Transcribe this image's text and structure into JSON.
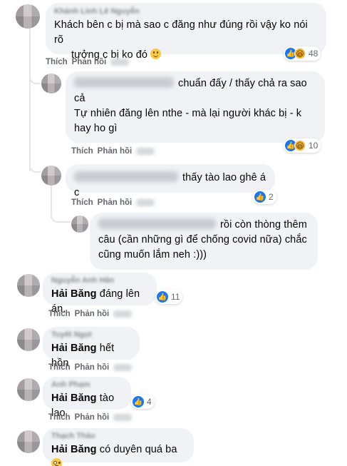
{
  "labels": {
    "like": "Thích",
    "reply": "Phản hồi",
    "separator": "·"
  },
  "comments": [
    {
      "id": "c1",
      "author": "Khánh Linh Lê Nguyễn",
      "lines": [
        "Khách bên c bị mà sao c đăng như đúng rồi vậy ko nói rõ",
        "tưởng c bị ko đó"
      ],
      "emoji": "smile-icon",
      "reactions": {
        "icons": [
          "like-icon",
          "haha-icon"
        ],
        "count": "48"
      }
    },
    {
      "id": "c2",
      "lines": [
        "chuẩn đấy / thấy chả ra sao",
        "cả",
        "Tự nhiên đăng lên nthe - mà lại người khác bị - k",
        "hay ho gì"
      ],
      "reactions": {
        "icons": [
          "like-icon",
          "haha-icon"
        ],
        "count": "10"
      }
    },
    {
      "id": "c3",
      "lines": [
        "thấy tào lao ghê á c"
      ],
      "reactions": {
        "icons": [
          "like-icon"
        ],
        "count": "2"
      }
    },
    {
      "id": "c4",
      "lines": [
        "rồi còn thòng thêm",
        "câu (cần những gì để chống covid nữa) chắc",
        "cũng muốn lắm neh :)))"
      ]
    },
    {
      "id": "c5",
      "author": "Nguyễn Anh Hân",
      "tag": "Hải Băng",
      "text": " đáng lên án.",
      "reactions": {
        "icons": [
          "like-icon"
        ],
        "count": "11"
      }
    },
    {
      "id": "c6",
      "author": "Tuyết Ngọt",
      "tag": "Hải Băng",
      "text": " hết hồn"
    },
    {
      "id": "c7",
      "author": "Anh Phạm",
      "tag": "Hải Băng",
      "text": " tào lao",
      "reactions": {
        "icons": [
          "like-icon"
        ],
        "count": "4"
      }
    },
    {
      "id": "c8",
      "author": "Thạch Thảo",
      "tag": "Hải Băng",
      "text": " có duyên quá ba",
      "emoji": "flushed-icon"
    }
  ],
  "colors": {
    "bubble": "#f0f2f5",
    "text": "#050505",
    "meta": "#65676b",
    "like": "#1877f2",
    "haha": "#f7b125"
  }
}
